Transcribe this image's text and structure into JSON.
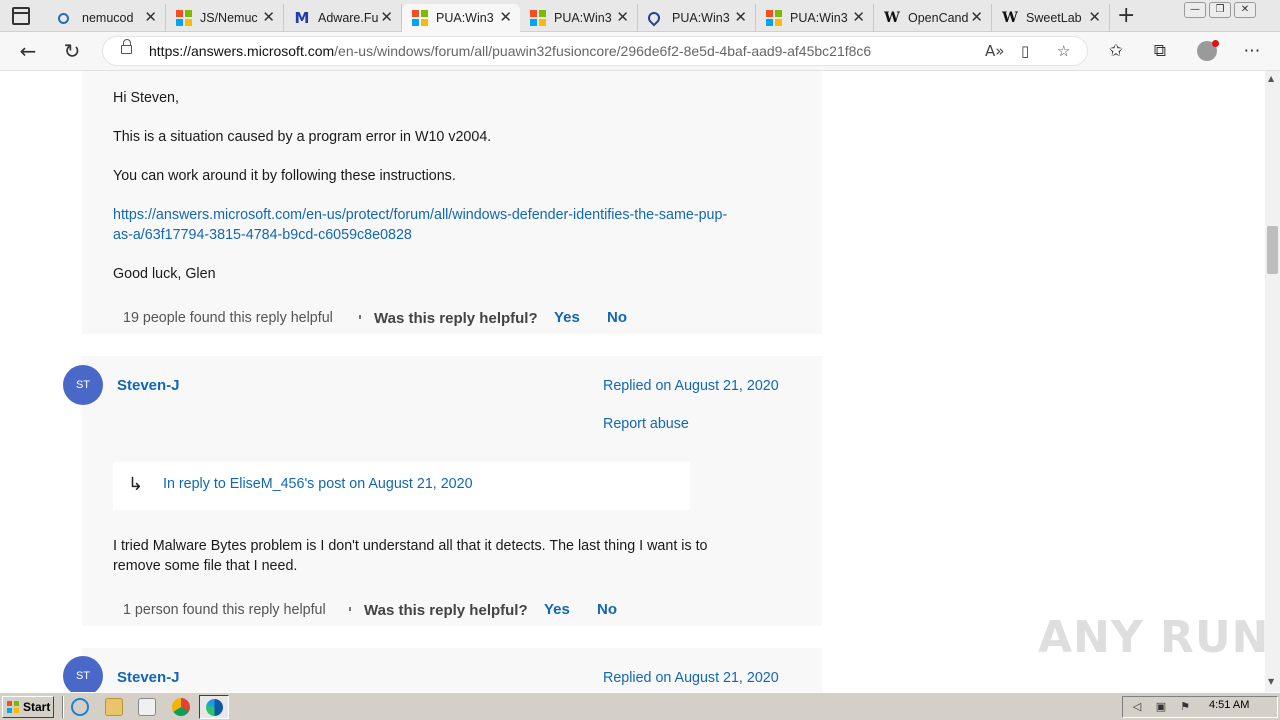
{
  "browser": {
    "tabs": [
      {
        "label": "nemucod",
        "favicon": "search-icon"
      },
      {
        "label": "JS/Nemuc",
        "favicon": "microsoft-icon"
      },
      {
        "label": "Adware.Fu",
        "favicon": "malwarebytes-icon"
      },
      {
        "label": "PUA:Win3",
        "favicon": "microsoft-icon",
        "active": true
      },
      {
        "label": "PUA:Win3",
        "favicon": "microsoft-icon"
      },
      {
        "label": "PUA:Win3",
        "favicon": "location-pin-icon"
      },
      {
        "label": "PUA:Win3",
        "favicon": "microsoft-icon"
      },
      {
        "label": "OpenCand",
        "favicon": "wikipedia-icon"
      },
      {
        "label": "SweetLab",
        "favicon": "wikipedia-icon"
      }
    ],
    "url_host": "https://answers.microsoft.com",
    "url_path": "/en-us/windows/forum/all/puawin32fusioncore/296de6f2-8e5d-4baf-aad9-af45bc21f8c6"
  },
  "thread": {
    "reply1": {
      "greeting": "Hi Steven,",
      "para1": "This is a situation caused by a program error in W10 v2004.",
      "para2": "You can work around it by following these instructions.",
      "link_line1": "https://answers.microsoft.com/en-us/protect/forum/all/windows-defender-identifies-the-same-pup-",
      "link_line2": "as-a/63f17794-3815-4784-b9cd-c6059c8e0828",
      "signoff": "Good luck,  Glen",
      "helpful_count": "19 people found this reply helpful",
      "helpful_question": "Was this reply helpful?",
      "yes": "Yes",
      "no": "No"
    },
    "reply2": {
      "avatar_initials": "ST",
      "author": "Steven-J",
      "replied": "Replied on August 21, 2020",
      "report": "Report abuse",
      "in_reply_to": "In reply to EliseM_456's post on August 21, 2020",
      "body_line1": "I tried Malware Bytes problem is I don't understand all that it detects.  The last thing I want is to",
      "body_line2": "remove some file that I need.",
      "helpful_count": "1 person found this reply helpful",
      "helpful_question": "Was this reply helpful?",
      "yes": "Yes",
      "no": "No"
    },
    "reply3": {
      "avatar_initials": "ST",
      "author": "Steven-J",
      "replied": "Replied on August 21, 2020"
    }
  },
  "watermark": "ANY RUN",
  "taskbar": {
    "start": "Start",
    "clock": "4:51 AM"
  },
  "colors": {
    "link": "#1267b4",
    "avatar": "#4a68c8",
    "card_bg": "#f8f8f8"
  }
}
